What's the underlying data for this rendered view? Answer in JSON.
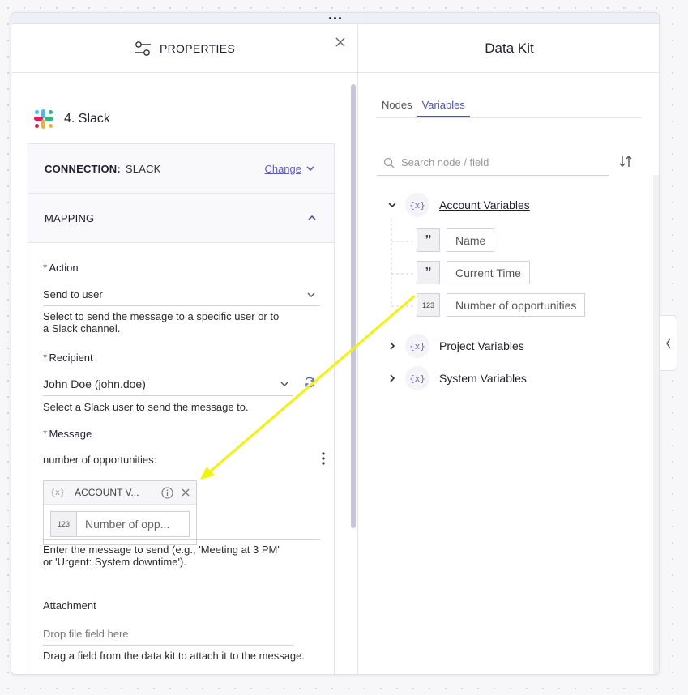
{
  "properties": {
    "title": "PROPERTIES",
    "node_title": "4. Slack",
    "connection": {
      "key": "CONNECTION:",
      "value": "SLACK",
      "change_label": "Change"
    },
    "mapping_label": "MAPPING",
    "action": {
      "label": "Action",
      "value": "Send to user",
      "help": "Select to send the message to a specific user or to a Slack channel."
    },
    "recipient": {
      "label": "Recipient",
      "value": "John Doe (john.doe)",
      "help": "Select a Slack user to send the message to."
    },
    "message": {
      "label": "Message",
      "text": "number of opportunities:",
      "token_group": "ACCOUNT V...",
      "token_type": "123",
      "token_value": "Number of opp...",
      "help": "Enter the message to send (e.g., 'Meeting at 3 PM' or 'Urgent: System downtime')."
    },
    "attachment": {
      "label": "Attachment",
      "placeholder": "Drop file field here",
      "help": "Drag a field from the data kit to attach it to the message."
    }
  },
  "data_kit": {
    "title": "Data Kit",
    "tabs": [
      {
        "label": "Nodes"
      },
      {
        "label": "Variables"
      }
    ],
    "search_placeholder": "Search node / field",
    "groups": [
      {
        "name": "Account Variables",
        "expanded": true,
        "items": [
          {
            "type": "text",
            "type_glyph": "”",
            "name": "Name"
          },
          {
            "type": "text",
            "type_glyph": "”",
            "name": "Current Time"
          },
          {
            "type": "number",
            "type_glyph": "123",
            "name": "Number of opportunities"
          }
        ]
      },
      {
        "name": "Project Variables",
        "expanded": false
      },
      {
        "name": "System Variables",
        "expanded": false
      }
    ],
    "var_icon": "{x}"
  },
  "colors": {
    "accent": "#4b51b8",
    "link": "#5a5fc7",
    "arrow": "#f2f20a"
  }
}
